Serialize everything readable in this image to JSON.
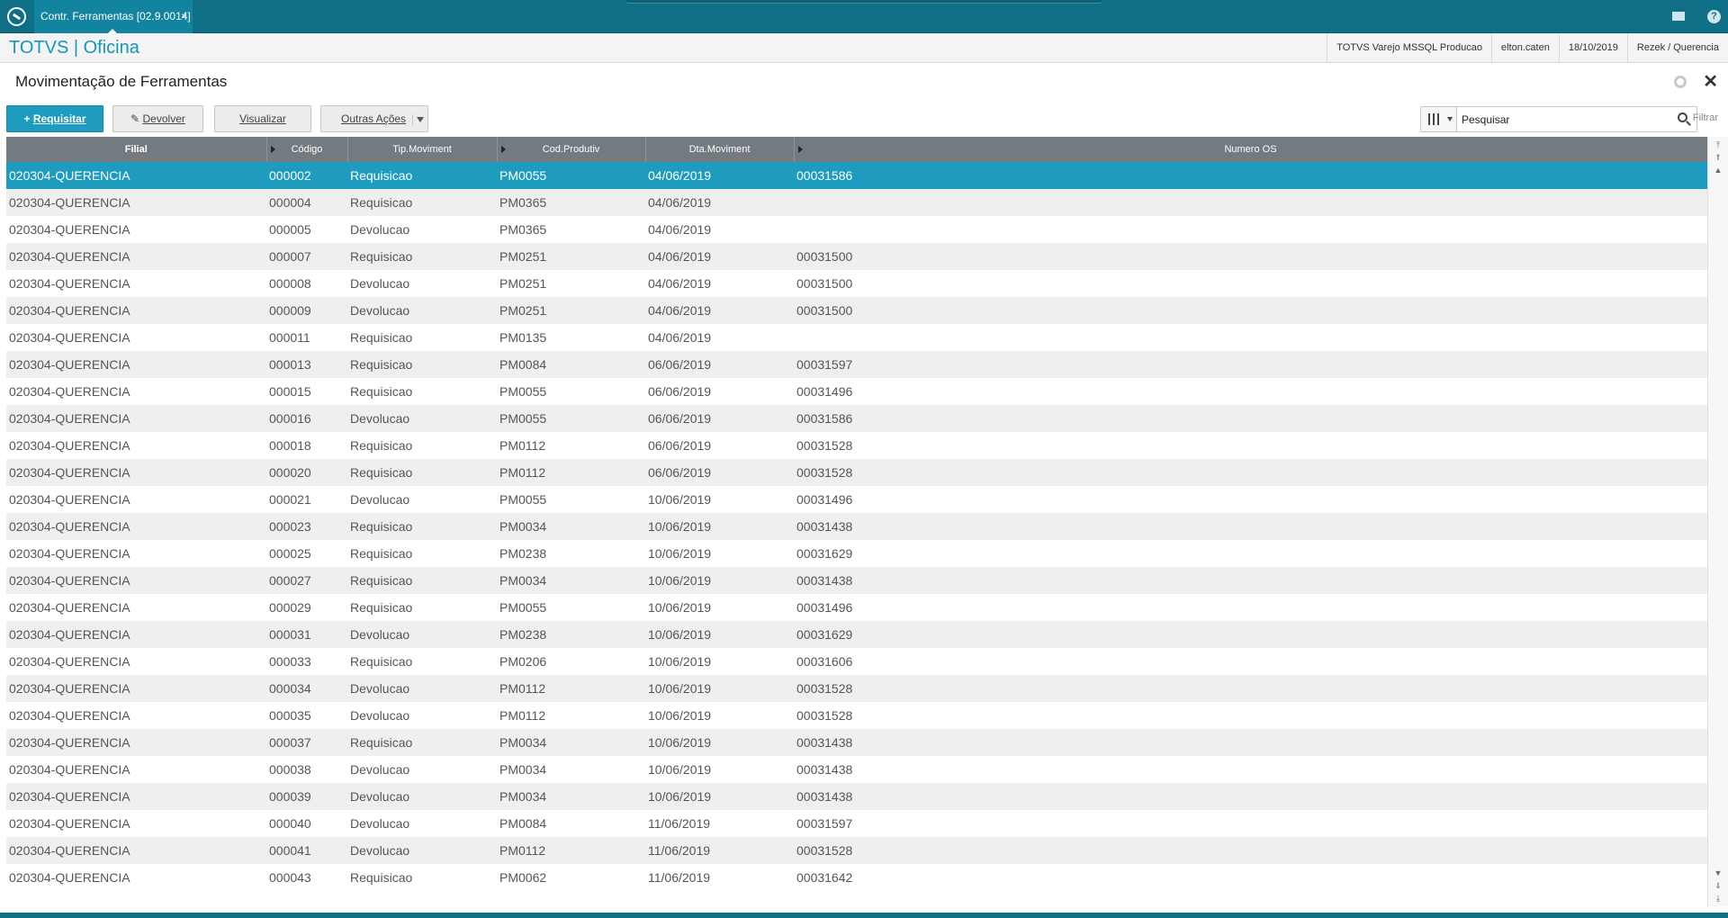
{
  "app": {
    "tab_title": "Contr. Ferramentas [02.9.0014]",
    "tab_close": "×",
    "brand": "TOTVS | Oficina"
  },
  "header_info": {
    "environment": "TOTVS Varejo MSSQL Producao",
    "user": "elton.caten",
    "date": "18/10/2019",
    "company": "Rezek / Querencia"
  },
  "page": {
    "title": "Movimentação de Ferramentas",
    "close": "✕"
  },
  "toolbar": {
    "requisitar_plus": "+",
    "requisitar_label": "Requisitar",
    "devolver_label": "Devolver",
    "visualizar_label": "Visualizar",
    "outras_label": "Outras Ações"
  },
  "search": {
    "placeholder": "Pesquisar",
    "filter_label": "Filtrar"
  },
  "grid": {
    "columns": [
      "Filial",
      "Código",
      "Tip.Moviment",
      "Cod.Produtiv",
      "Dta.Moviment",
      "Numero OS"
    ],
    "rows": [
      [
        "020304-QUERENCIA",
        "000002",
        "Requisicao",
        "PM0055",
        "04/06/2019",
        "00031586"
      ],
      [
        "020304-QUERENCIA",
        "000004",
        "Requisicao",
        "PM0365",
        "04/06/2019",
        ""
      ],
      [
        "020304-QUERENCIA",
        "000005",
        "Devolucao",
        "PM0365",
        "04/06/2019",
        ""
      ],
      [
        "020304-QUERENCIA",
        "000007",
        "Requisicao",
        "PM0251",
        "04/06/2019",
        "00031500"
      ],
      [
        "020304-QUERENCIA",
        "000008",
        "Devolucao",
        "PM0251",
        "04/06/2019",
        "00031500"
      ],
      [
        "020304-QUERENCIA",
        "000009",
        "Devolucao",
        "PM0251",
        "04/06/2019",
        "00031500"
      ],
      [
        "020304-QUERENCIA",
        "000011",
        "Requisicao",
        "PM0135",
        "04/06/2019",
        ""
      ],
      [
        "020304-QUERENCIA",
        "000013",
        "Requisicao",
        "PM0084",
        "06/06/2019",
        "00031597"
      ],
      [
        "020304-QUERENCIA",
        "000015",
        "Requisicao",
        "PM0055",
        "06/06/2019",
        "00031496"
      ],
      [
        "020304-QUERENCIA",
        "000016",
        "Devolucao",
        "PM0055",
        "06/06/2019",
        "00031586"
      ],
      [
        "020304-QUERENCIA",
        "000018",
        "Requisicao",
        "PM0112",
        "06/06/2019",
        "00031528"
      ],
      [
        "020304-QUERENCIA",
        "000020",
        "Requisicao",
        "PM0112",
        "06/06/2019",
        "00031528"
      ],
      [
        "020304-QUERENCIA",
        "000021",
        "Devolucao",
        "PM0055",
        "10/06/2019",
        "00031496"
      ],
      [
        "020304-QUERENCIA",
        "000023",
        "Requisicao",
        "PM0034",
        "10/06/2019",
        "00031438"
      ],
      [
        "020304-QUERENCIA",
        "000025",
        "Requisicao",
        "PM0238",
        "10/06/2019",
        "00031629"
      ],
      [
        "020304-QUERENCIA",
        "000027",
        "Requisicao",
        "PM0034",
        "10/06/2019",
        "00031438"
      ],
      [
        "020304-QUERENCIA",
        "000029",
        "Requisicao",
        "PM0055",
        "10/06/2019",
        "00031496"
      ],
      [
        "020304-QUERENCIA",
        "000031",
        "Devolucao",
        "PM0238",
        "10/06/2019",
        "00031629"
      ],
      [
        "020304-QUERENCIA",
        "000033",
        "Requisicao",
        "PM0206",
        "10/06/2019",
        "00031606"
      ],
      [
        "020304-QUERENCIA",
        "000034",
        "Devolucao",
        "PM0112",
        "10/06/2019",
        "00031528"
      ],
      [
        "020304-QUERENCIA",
        "000035",
        "Devolucao",
        "PM0112",
        "10/06/2019",
        "00031528"
      ],
      [
        "020304-QUERENCIA",
        "000037",
        "Requisicao",
        "PM0034",
        "10/06/2019",
        "00031438"
      ],
      [
        "020304-QUERENCIA",
        "000038",
        "Devolucao",
        "PM0034",
        "10/06/2019",
        "00031438"
      ],
      [
        "020304-QUERENCIA",
        "000039",
        "Devolucao",
        "PM0034",
        "10/06/2019",
        "00031438"
      ],
      [
        "020304-QUERENCIA",
        "000040",
        "Devolucao",
        "PM0084",
        "11/06/2019",
        "00031597"
      ],
      [
        "020304-QUERENCIA",
        "000041",
        "Devolucao",
        "PM0112",
        "11/06/2019",
        "00031528"
      ],
      [
        "020304-QUERENCIA",
        "000043",
        "Requisicao",
        "PM0062",
        "11/06/2019",
        "00031642"
      ]
    ]
  },
  "colors": {
    "topbar": "#0f6f86",
    "brand": "#1497bb",
    "accent": "#1d9cc0",
    "header_bg": "#747b80",
    "row_alt": "#efefef"
  }
}
